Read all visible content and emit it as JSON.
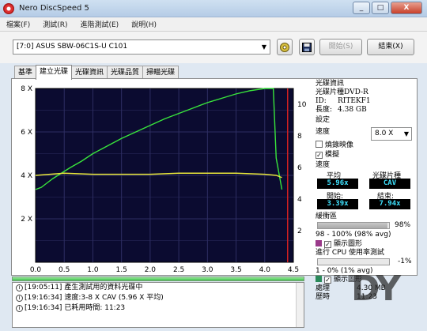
{
  "window": {
    "title": "Nero DiscSpeed 5",
    "minimize": "_",
    "maximize": "□",
    "close": "X"
  },
  "menu": [
    "檔案(F)",
    "測試(R)",
    "進階測試(E)",
    "說明(H)"
  ],
  "toolbar": {
    "drive": "[7:0]  ASUS SBW-06C1S-U C101",
    "start_label": "開始(S)",
    "exit_label": "結束(X)"
  },
  "tabs": [
    "基準",
    "建立光碟",
    "光碟資訊",
    "光碟品質",
    "掃瞄光碟"
  ],
  "active_tab": "建立光碟",
  "chart_data": {
    "type": "line",
    "x_ticks": [
      "0.0",
      "0.5",
      "1.0",
      "1.5",
      "2.0",
      "2.5",
      "3.0",
      "3.5",
      "4.0",
      "4.5"
    ],
    "xlim": [
      0,
      4.5
    ],
    "y_left_ticks": [
      "8 X",
      "6 X",
      "4 X",
      "2 X"
    ],
    "ylim_left": [
      0,
      8
    ],
    "y_right_ticks": [
      "10",
      "8",
      "6",
      "4",
      "2"
    ],
    "ylim_right": [
      0,
      11
    ],
    "grid": true,
    "colors": {
      "background": "#0b0b30",
      "grid": "#2e2e62",
      "speed": "#39e53c",
      "rpm": "#e8e63a",
      "marker": "#d22020"
    },
    "series": [
      {
        "color": "#39e53c",
        "x": [
          0.0,
          0.1,
          0.2,
          0.3,
          0.45,
          0.6,
          0.8,
          1.0,
          1.25,
          1.5,
          1.75,
          2.0,
          2.25,
          2.5,
          2.75,
          3.0,
          3.25,
          3.5,
          3.75,
          4.0,
          4.15,
          4.2,
          4.3
        ],
        "y": [
          3.35,
          3.45,
          3.65,
          3.85,
          4.1,
          4.35,
          4.65,
          5.0,
          5.35,
          5.7,
          6.0,
          6.3,
          6.6,
          6.85,
          7.1,
          7.35,
          7.55,
          7.75,
          7.9,
          8.0,
          8.0,
          4.8,
          3.35
        ]
      },
      {
        "color": "#e8e63a",
        "x": [
          0.0,
          0.5,
          1.0,
          1.5,
          2.0,
          2.5,
          3.0,
          3.5,
          4.0,
          4.2,
          4.3
        ],
        "y": [
          4.0,
          4.1,
          4.05,
          4.05,
          4.05,
          4.1,
          4.1,
          4.1,
          4.05,
          4.0,
          3.9
        ]
      }
    ],
    "marker_x": 4.4
  },
  "info": {
    "disc_info_title": "光碟資訊",
    "disc_type_label": "光碟片種",
    "disc_type_value": "DVD-R",
    "id_label": "ID:",
    "id_value": "RITEKF1",
    "length_label": "長度:",
    "length_value": "4.38 GB",
    "settings_title": "設定",
    "speed_label": "速度",
    "speed_value": "8.0 X",
    "image_label": "燒錄映像",
    "simulate_label": "模擬",
    "speed_title": "速度",
    "avg_label": "平均",
    "avg_value": "5.96x",
    "disc_kind_label": "光碟片種",
    "disc_kind_value": "CAV",
    "start_label": "開始:",
    "start_value": "3.39x",
    "end_label": "結束:",
    "end_value": "7.94x",
    "buffer_title": "緩衝區",
    "buffer_percent": "98%",
    "buffer_fraction": 0.98,
    "buffer_range": "98 - 100% (98% avg)",
    "show_graph_label": "顯示圖形",
    "cpu_label": "進行 CPU 使用率測試",
    "cpu_value": "-1%",
    "cpu_range": "1 - 0% (1% avg)",
    "cpu_graph_label": "顯示圖形",
    "process_label": "處理",
    "process_value": "4.30 MB",
    "elapsed_label": "歷時",
    "elapsed_value": "11:23",
    "colors": {
      "buffer_swatch": "#9a3a8a",
      "cpu_swatch": "#2a8a5a"
    }
  },
  "progress_fraction": 1.0,
  "log": [
    {
      "time": "[19:05:11]",
      "text": "產生測試用的資料光碟中"
    },
    {
      "time": "[19:16:34]",
      "text": "速度:3-8 X CAV (5.96 X 平均)"
    },
    {
      "time": "[19:16:34]",
      "text": "已耗用時間: 11:23"
    }
  ],
  "watermark": "DY"
}
